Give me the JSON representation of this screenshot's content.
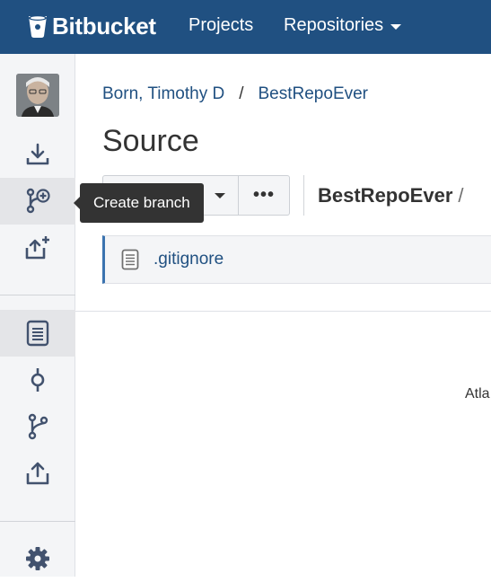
{
  "header": {
    "brand": "Bitbucket",
    "nav": [
      {
        "label": "Projects"
      },
      {
        "label": "Repositories"
      }
    ]
  },
  "sidebar": {
    "items": [
      {
        "name": "clone",
        "icon": "download-icon"
      },
      {
        "name": "create-branch",
        "icon": "create-branch-icon"
      },
      {
        "name": "create-pull-request",
        "icon": "upload-plus-icon"
      },
      {
        "name": "source",
        "icon": "document-icon"
      },
      {
        "name": "commits",
        "icon": "commit-icon"
      },
      {
        "name": "branches",
        "icon": "branch-icon"
      },
      {
        "name": "pull-requests",
        "icon": "upload-icon"
      },
      {
        "name": "settings",
        "icon": "gear-icon"
      }
    ]
  },
  "tooltip": {
    "text": "Create branch"
  },
  "breadcrumb": {
    "project": "Born, Timothy D",
    "separator": "/",
    "repo": "BestRepoEver"
  },
  "page": {
    "title": "Source"
  },
  "toolbar": {
    "more_label": "•••",
    "path_repo": "BestRepoEver",
    "path_sep": "/"
  },
  "files": [
    {
      "name": ".gitignore",
      "icon": "file-icon"
    }
  ],
  "footer": {
    "partial_text": "Atla"
  },
  "colors": {
    "header_bg": "#205081",
    "link": "#205081",
    "sidebar_bg": "#f4f5f7",
    "tooltip_bg": "#333333",
    "file_accent": "#3b73af"
  }
}
